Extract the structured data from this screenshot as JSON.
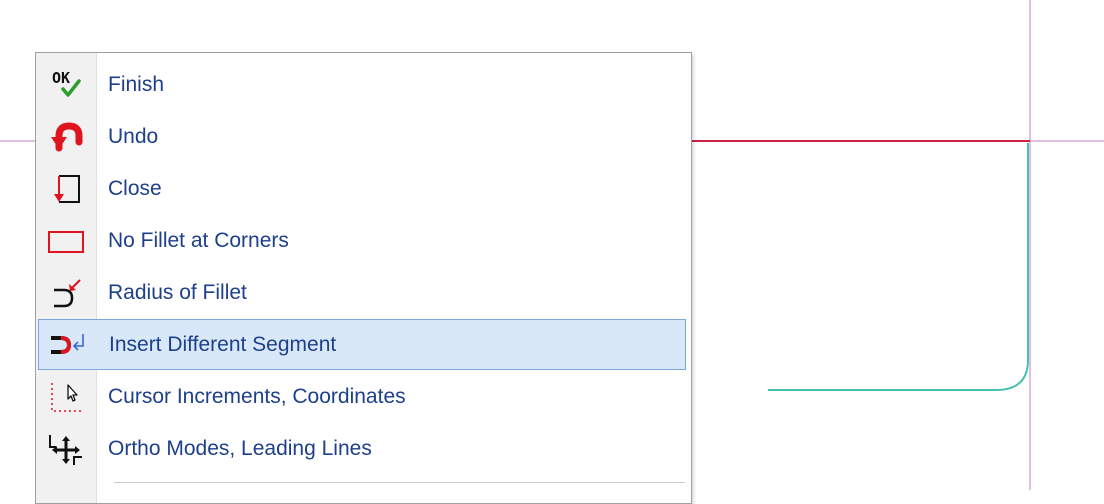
{
  "colors": {
    "crosshair": "#cc99cc",
    "profile_line": "#cc2244",
    "offset_line": "#44c4b0",
    "menu_text": "#1d3f8c",
    "highlight": "#d9e8f8"
  },
  "menu": {
    "items": [
      {
        "label": "Finish",
        "icon": "ok-check-icon"
      },
      {
        "label": "Undo",
        "icon": "undo-icon"
      },
      {
        "label": "Close",
        "icon": "close-polyline-icon"
      },
      {
        "label": "No Fillet at Corners",
        "icon": "rectangle-icon"
      },
      {
        "label": "Radius of Fillet",
        "icon": "fillet-radius-icon"
      },
      {
        "label": "Insert Different Segment",
        "icon": "insert-segment-icon"
      },
      {
        "label": "Cursor Increments, Coordinates",
        "icon": "cursor-increment-icon"
      },
      {
        "label": "Ortho Modes, Leading Lines",
        "icon": "ortho-mode-icon"
      }
    ],
    "highlighted_index": 5
  },
  "icon_text": {
    "ok": "OK"
  }
}
